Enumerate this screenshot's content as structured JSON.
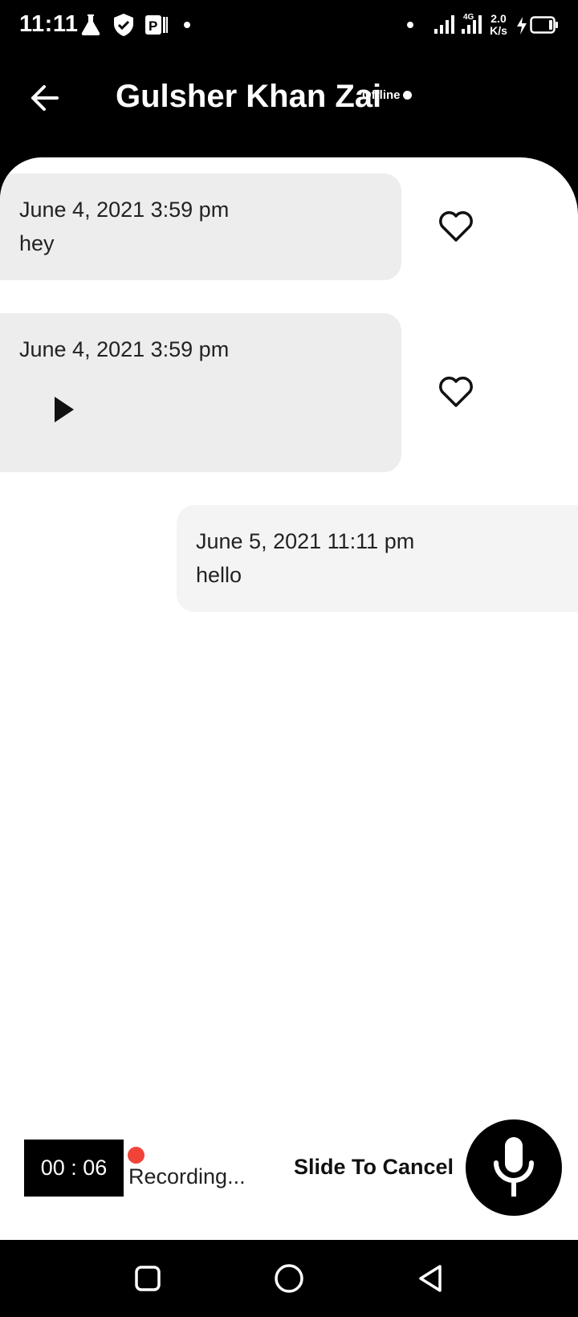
{
  "status_bar": {
    "time": "11:11",
    "net_speed_value": "2.0",
    "net_speed_unit": "K/s",
    "network_type": "4G",
    "icons": [
      "flask-icon",
      "shield-icon",
      "parking-icon",
      "dot-icon",
      "signal-icon",
      "battery-icon"
    ]
  },
  "header": {
    "contact_name": "Gulsher Khan Zai",
    "presence": "Offline"
  },
  "messages": [
    {
      "direction": "incoming",
      "timestamp": "June 4, 2021 3:59 pm",
      "text": "hey"
    },
    {
      "direction": "incoming",
      "timestamp": "June 4, 2021 3:59 pm",
      "type": "voice"
    },
    {
      "direction": "outgoing",
      "timestamp": "June 5, 2021 11:11 pm",
      "text": "hello"
    }
  ],
  "recorder": {
    "timer": "00 : 06",
    "status": "Recording...",
    "cancel_hint": "Slide To Cancel",
    "dot_color": "#f04438"
  },
  "colors": {
    "header_bg": "#000000",
    "incoming_bubble": "#ededed",
    "outgoing_bubble": "#f4f4f4"
  }
}
